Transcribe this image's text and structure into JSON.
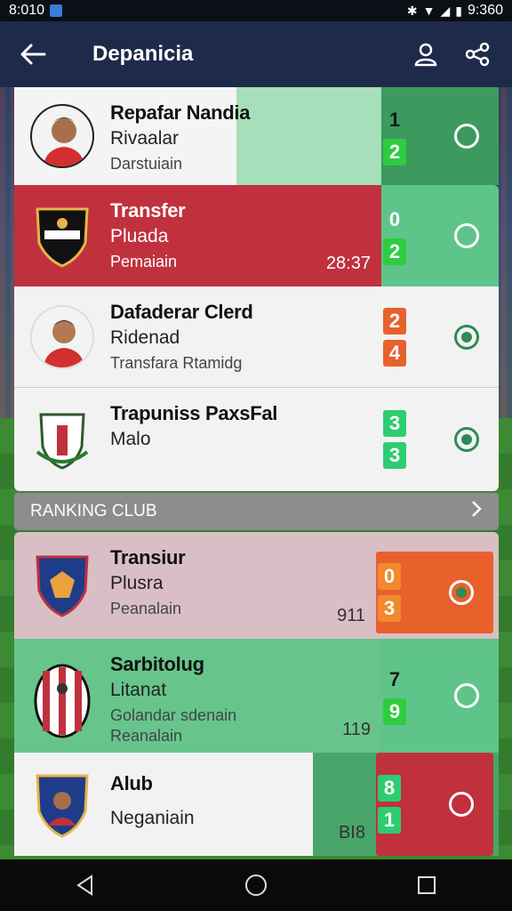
{
  "status": {
    "time_left": "8:010",
    "time_right": "9:360"
  },
  "appbar": {
    "title": "Depanicia"
  },
  "section": {
    "title": "RANKING CLUB"
  },
  "items": [
    {
      "line1": "Repafar Nandia",
      "line2": "Rivaalar",
      "line3": "Darstuiain",
      "stamp": "",
      "score_top": "1",
      "score_bottom": "2"
    },
    {
      "line1": "Transfer",
      "line2": "Pluada",
      "line3": "Pemaiain",
      "stamp": "28:37",
      "score_top": "0",
      "score_bottom": "2"
    },
    {
      "line1": "Dafaderar Clerd",
      "line2": "Ridenad",
      "line3": "Transfara Rtamidg",
      "stamp": "",
      "score_top": "2",
      "score_bottom": "4"
    },
    {
      "line1": "Trapuniss PaxsFal",
      "line2": "Malo",
      "line3": "",
      "stamp": "",
      "score_top": "3",
      "score_bottom": "3"
    },
    {
      "line1": "Transiur",
      "line2": "Plusra",
      "line3": "Peanalain",
      "stamp": "911",
      "score_top": "0",
      "score_bottom": "3"
    },
    {
      "line1": "Sarbitolug",
      "line2": "Litanat",
      "line3": "Golandar sdenain",
      "line4": "Reanalain",
      "stamp": "119",
      "score_top": "7",
      "score_bottom": "9"
    },
    {
      "line1": "Alub",
      "line2": "Neganiain",
      "line3": "",
      "stamp": "BI8",
      "score_top": "8",
      "score_bottom": "1"
    }
  ],
  "colors": {
    "appbar": "#1e2a4a",
    "accent_green": "#2ecc71",
    "accent_red": "#c0313d",
    "accent_orange": "#e8612c"
  }
}
